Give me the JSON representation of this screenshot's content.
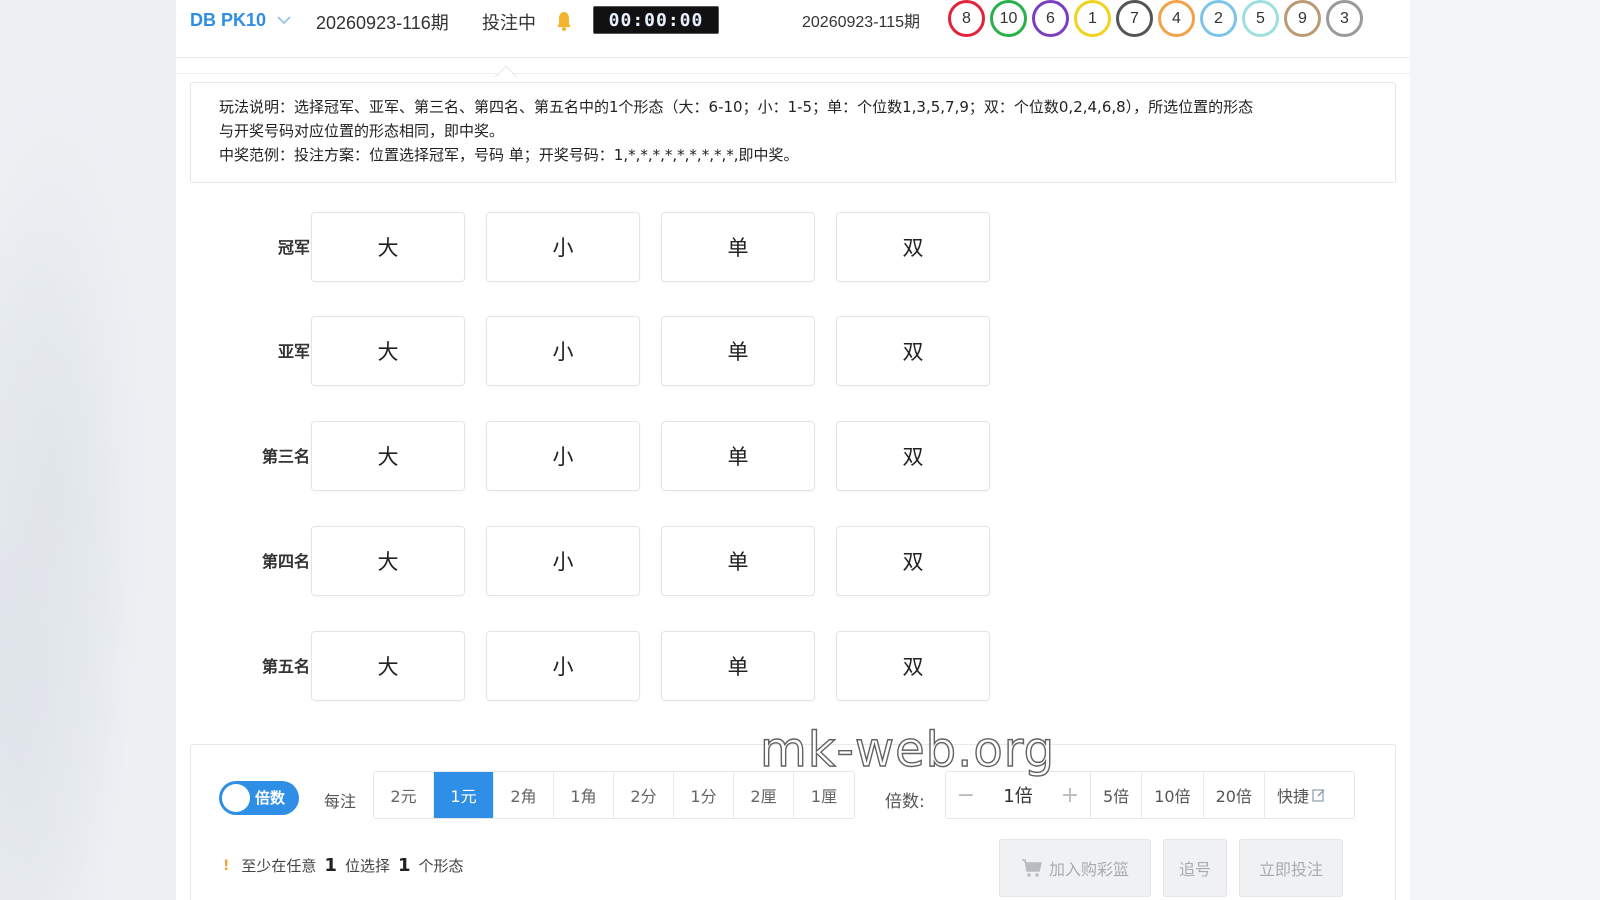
{
  "header": {
    "game_name": "DB PK10",
    "current_issue": "20260923-116期",
    "status": "投注中",
    "countdown": "00:00:00",
    "last_issue": "20260923-115期",
    "result_balls": [
      {
        "num": "8",
        "color": "#e0243a"
      },
      {
        "num": "10",
        "color": "#28b04a"
      },
      {
        "num": "6",
        "color": "#7a3fc1"
      },
      {
        "num": "1",
        "color": "#f2d21a"
      },
      {
        "num": "7",
        "color": "#555555"
      },
      {
        "num": "4",
        "color": "#f0a34a"
      },
      {
        "num": "2",
        "color": "#7cc4ea"
      },
      {
        "num": "5",
        "color": "#9ee0e0"
      },
      {
        "num": "9",
        "color": "#b99a74"
      },
      {
        "num": "3",
        "color": "#9a9a9a"
      }
    ]
  },
  "rules": {
    "line1": "玩法说明：选择冠军、亚军、第三名、第四名、第五名中的1个形态（大：6-10；小：1-5；单：个位数1,3,5,7,9；双：个位数0,2,4,6,8），所选位置的形态",
    "line2": "与开奖号码对应位置的形态相同，即中奖。",
    "line3": "中奖范例：投注方案：位置选择冠军，号码 单；开奖号码：1,*,*,*,*,*,*,*,*,*,即中奖。"
  },
  "positions": [
    {
      "label": "冠军",
      "options": [
        "大",
        "小",
        "单",
        "双"
      ]
    },
    {
      "label": "亚军",
      "options": [
        "大",
        "小",
        "单",
        "双"
      ]
    },
    {
      "label": "第三名",
      "options": [
        "大",
        "小",
        "单",
        "双"
      ]
    },
    {
      "label": "第四名",
      "options": [
        "大",
        "小",
        "单",
        "双"
      ]
    },
    {
      "label": "第五名",
      "options": [
        "大",
        "小",
        "单",
        "双"
      ]
    }
  ],
  "bet": {
    "toggle_label": "倍数",
    "unit_label": "每注",
    "units": [
      "2元",
      "1元",
      "2角",
      "1角",
      "2分",
      "1分",
      "2厘",
      "1厘"
    ],
    "active_unit": "1元",
    "multiplier_label": "倍数:",
    "minus": "−",
    "plus": "+",
    "multiplier_value": "1倍",
    "quick_multipliers": [
      "5倍",
      "10倍",
      "20倍"
    ],
    "quick_label": "快捷",
    "hint_prefix": "至少在任意",
    "hint_num1": "1",
    "hint_middle": "位选择",
    "hint_num2": "1",
    "hint_suffix": "个形态",
    "add_cart_label": "加入购彩篮",
    "chase_label": "追号",
    "bet_now_label": "立即投注",
    "accent_color": "#2f8ee5"
  },
  "watermark": "mk-web.org"
}
